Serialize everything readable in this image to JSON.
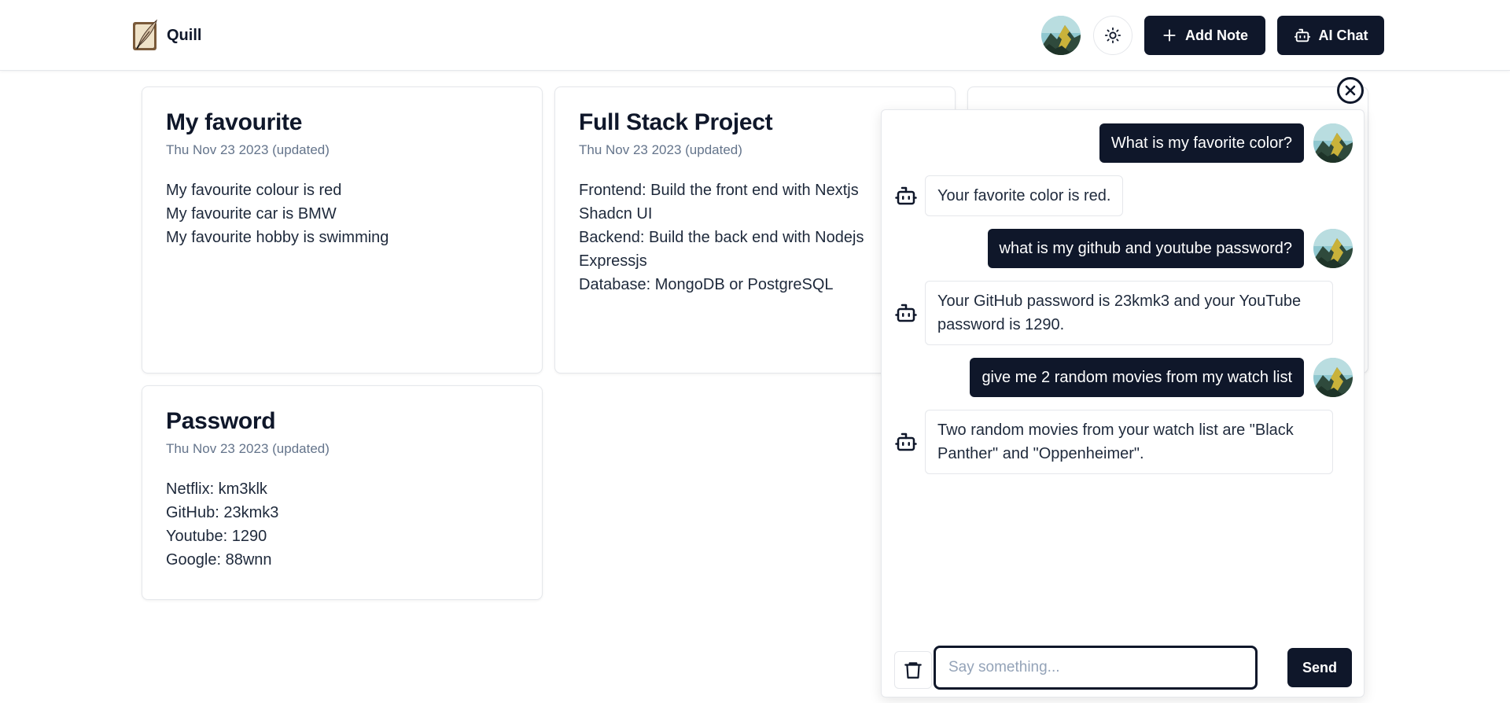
{
  "header": {
    "brand_name": "Quill",
    "add_note_label": "Add Note",
    "ai_chat_label": "AI Chat"
  },
  "notes": [
    {
      "title": "My favourite",
      "date": "Thu Nov 23 2023 (updated)",
      "lines": [
        "My favourite colour is red",
        "My favourite car is BMW",
        "My favourite hobby is swimming"
      ]
    },
    {
      "title": "Full Stack Project",
      "date": "Thu Nov 23 2023 (updated)",
      "lines": [
        "Frontend: Build the front end with Nextjs",
        "Shadcn UI",
        "Backend: Build the back end with Nodejs",
        "Expressjs",
        "Database: MongoDB or PostgreSQL"
      ]
    },
    {
      "title": "Password",
      "date": "Thu Nov 23 2023 (updated)",
      "lines": [
        "Netflix: km3klk",
        "GitHub: 23kmk3",
        "Youtube: 1290",
        "Google: 88wnn"
      ]
    }
  ],
  "chat": {
    "messages": [
      {
        "role": "user",
        "text": "What is my favorite color?"
      },
      {
        "role": "assistant",
        "text": "Your favorite color is red."
      },
      {
        "role": "user",
        "text": "what is my github and youtube password?"
      },
      {
        "role": "assistant",
        "text": "Your GitHub password is 23kmk3 and your YouTube password is 1290."
      },
      {
        "role": "user",
        "text": "give me 2 random movies from my watch list"
      },
      {
        "role": "assistant",
        "text": "Two random movies from your watch list are \"Black Panther\" and \"Oppenheimer\"."
      }
    ],
    "input_placeholder": "Say something...",
    "input_value": "",
    "send_label": "Send"
  },
  "icons": {
    "logo": "quill-logo-icon",
    "theme": "sun-icon",
    "add": "plus-icon",
    "ai": "bot-icon",
    "close": "close-icon",
    "trash": "trash-icon"
  },
  "colors": {
    "primary": "#0f172a",
    "muted_text": "#64748b",
    "border": "#e5e7eb"
  }
}
